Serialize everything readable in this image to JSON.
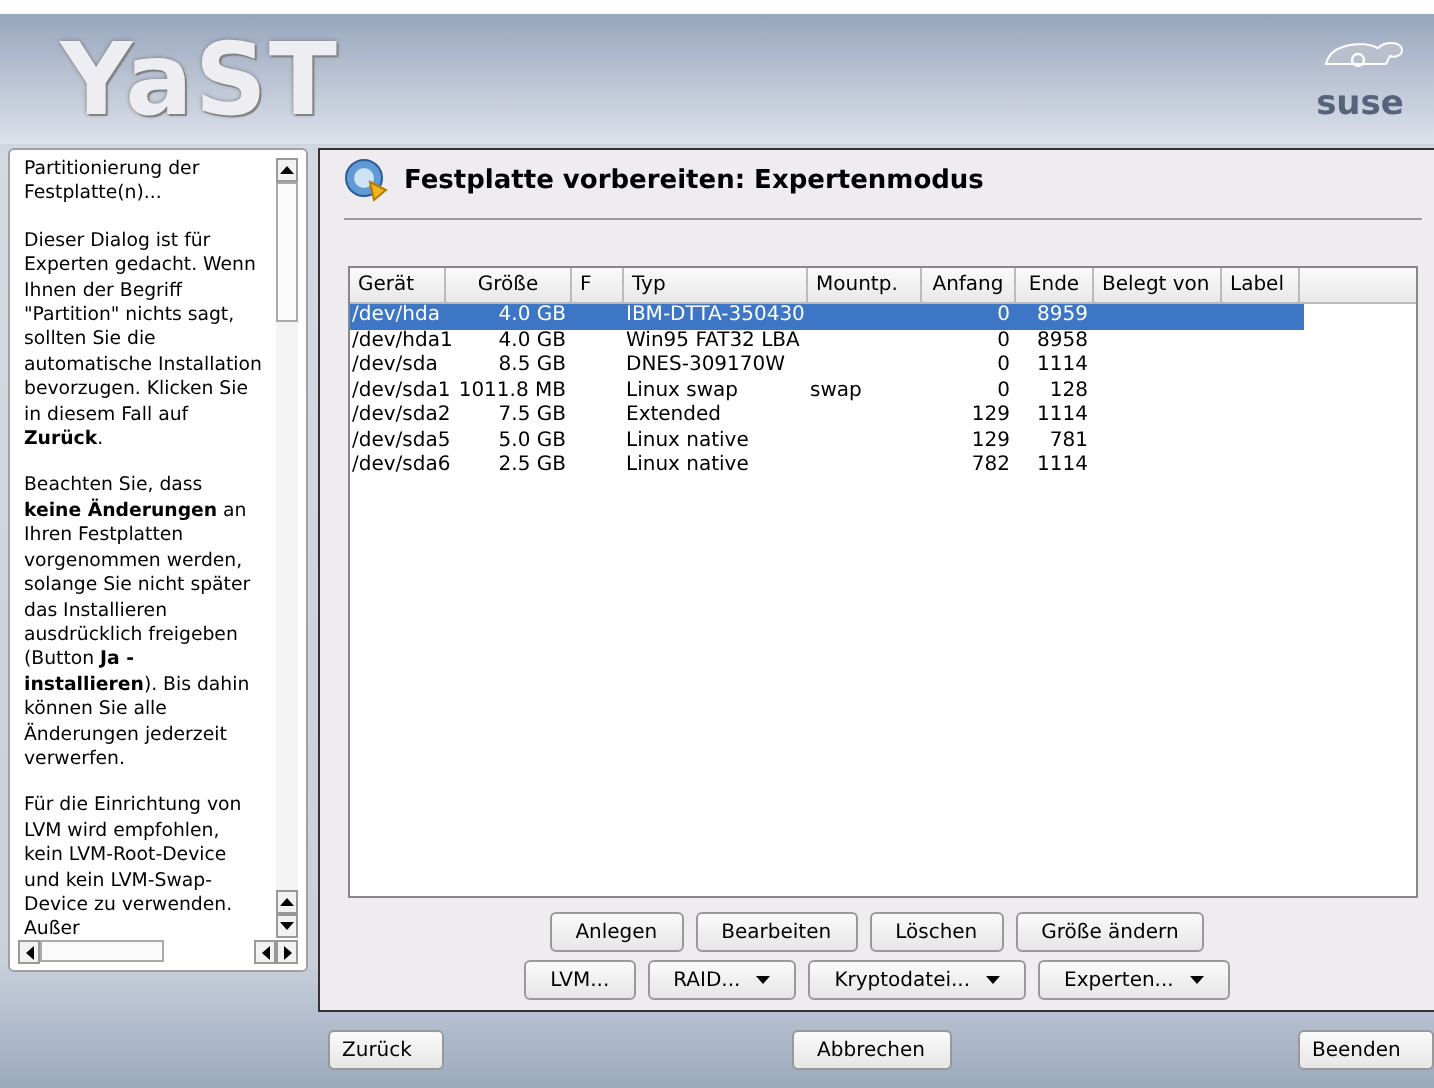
{
  "header": {
    "title": "YaST",
    "logo": "suse"
  },
  "help": {
    "paragraphs": [
      "Partitionierung der Festplatte(n)...",
      "Dieser Dialog ist für Experten gedacht. Wenn Ihnen der Begriff \"Partition\" nichts sagt, sollten Sie die automatische Installation bevorzugen. Klicken Sie in diesem Fall auf **Zurück**.",
      "Beachten Sie, dass **keine Änderungen** an Ihren Festplatten vorgenommen werden, solange Sie nicht später das Installieren ausdrücklich freigeben (Button **Ja - installieren**). Bis dahin können Sie alle Änderungen jederzeit verwerfen.",
      "Für die Einrichtung von LVM wird empfohlen, kein LVM-Root-Device und kein LVM-Swap-Device zu verwenden. Außer"
    ]
  },
  "dialog": {
    "title": "Festplatte vorbereiten: Expertenmodus"
  },
  "table": {
    "columns": [
      "Gerät",
      "Größe",
      "F",
      "Typ",
      "Mountp.",
      "Anfang",
      "Ende",
      "Belegt von",
      "Label"
    ],
    "rows": [
      {
        "selected": true,
        "cells": [
          "/dev/hda",
          "4.0 GB",
          "",
          "IBM-DTTA-350430",
          "",
          "0",
          "8959",
          "",
          ""
        ]
      },
      {
        "selected": false,
        "cells": [
          "/dev/hda1",
          "4.0 GB",
          "",
          "Win95 FAT32 LBA",
          "",
          "0",
          "8958",
          "",
          ""
        ]
      },
      {
        "selected": false,
        "cells": [
          "/dev/sda",
          "8.5 GB",
          "",
          "DNES-309170W",
          "",
          "0",
          "1114",
          "",
          ""
        ]
      },
      {
        "selected": false,
        "cells": [
          "/dev/sda1",
          "1011.8 MB",
          "",
          "Linux swap",
          "swap",
          "0",
          "128",
          "",
          ""
        ]
      },
      {
        "selected": false,
        "cells": [
          "/dev/sda2",
          "7.5 GB",
          "",
          "Extended",
          "",
          "129",
          "1114",
          "",
          ""
        ]
      },
      {
        "selected": false,
        "cells": [
          "/dev/sda5",
          "5.0 GB",
          "",
          "Linux native",
          "",
          "129",
          "781",
          "",
          ""
        ]
      },
      {
        "selected": false,
        "cells": [
          "/dev/sda6",
          "2.5 GB",
          "",
          "Linux native",
          "",
          "782",
          "1114",
          "",
          ""
        ]
      }
    ]
  },
  "actions": [
    [
      {
        "label": "Anlegen",
        "menu": false
      },
      {
        "label": "Bearbeiten",
        "menu": false
      },
      {
        "label": "Löschen",
        "menu": false
      },
      {
        "label": "Größe ändern",
        "menu": false
      }
    ],
    [
      {
        "label": "LVM...",
        "menu": false
      },
      {
        "label": "RAID...",
        "menu": true
      },
      {
        "label": "Kryptodatei...",
        "menu": true
      },
      {
        "label": "Experten...",
        "menu": true
      }
    ]
  ],
  "footer": {
    "back": "Zurück",
    "cancel": "Abbrechen",
    "finish": "Beenden"
  }
}
